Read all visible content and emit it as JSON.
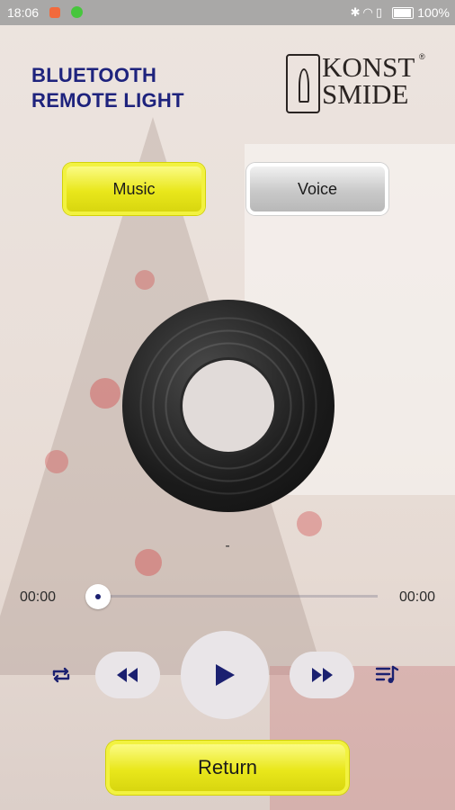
{
  "status_bar": {
    "time": "18:06",
    "battery_percent": "100%",
    "icons": [
      "notification-app-icon",
      "notification-app-icon",
      "bluetooth-icon",
      "wifi-icon",
      "sim-icon",
      "battery-icon"
    ]
  },
  "header": {
    "title_line1": "BLUETOOTH",
    "title_line2": "REMOTE LIGHT",
    "brand_line1": "KONST",
    "brand_line2": "SMIDE",
    "brand_mark": "®"
  },
  "modes": {
    "music_label": "Music",
    "voice_label": "Voice",
    "selected": "Music"
  },
  "player": {
    "track_title": "-",
    "current_time": "00:00",
    "total_time": "00:00",
    "progress": 0
  },
  "controls": {
    "icons": [
      "repeat-icon",
      "previous-icon",
      "play-icon",
      "next-icon",
      "playlist-icon"
    ]
  },
  "footer": {
    "return_label": "Return"
  },
  "colors": {
    "accent_yellow": "#e9e71b",
    "title_blue": "#1e237d",
    "icon_navy": "#1b2070",
    "statusbar": "#a9a8a7"
  }
}
